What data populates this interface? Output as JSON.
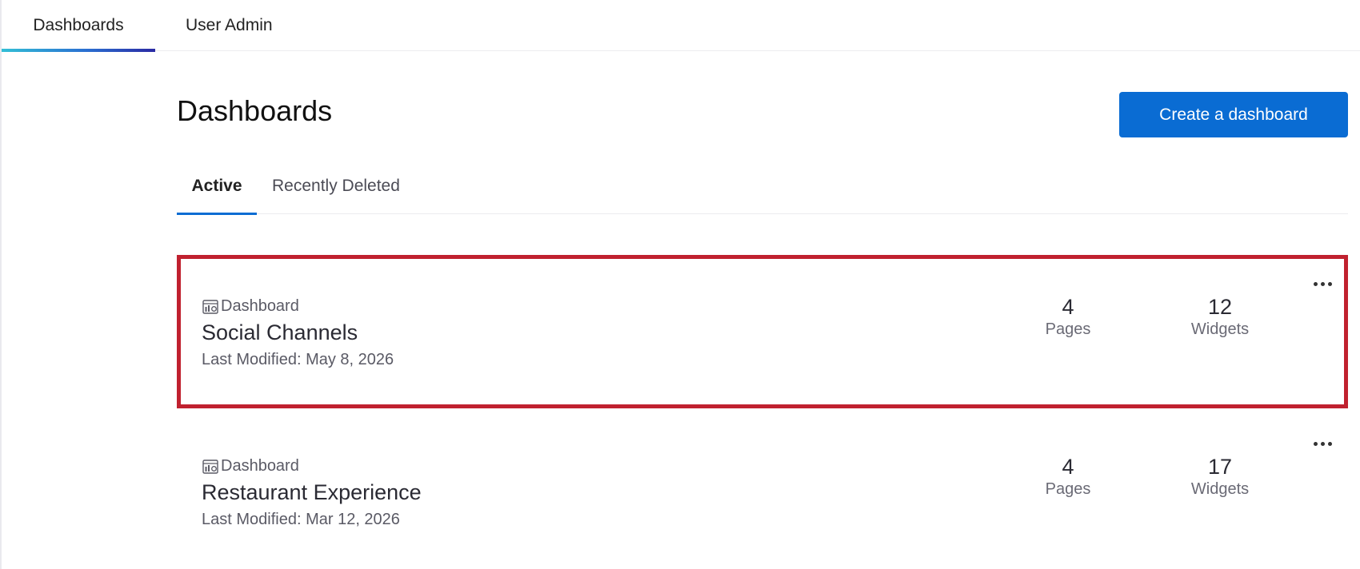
{
  "topnav": {
    "tabs": [
      {
        "label": "Dashboards",
        "active": true
      },
      {
        "label": "User Admin",
        "active": false
      }
    ]
  },
  "header": {
    "title": "Dashboards",
    "create_button": "Create a dashboard"
  },
  "subtabs": [
    {
      "label": "Active",
      "active": true
    },
    {
      "label": "Recently Deleted",
      "active": false
    }
  ],
  "cards": [
    {
      "type_label": "Dashboard",
      "type_icon": "dashboard-icon",
      "name": "Social Channels",
      "modified": "Last Modified: May 8, 2026",
      "pages_count": "4",
      "pages_label": "Pages",
      "widgets_count": "12",
      "widgets_label": "Widgets",
      "highlighted": true
    },
    {
      "type_label": "Dashboard",
      "type_icon": "dashboard-icon",
      "name": "Restaurant Experience",
      "modified": "Last Modified: Mar 12, 2026",
      "pages_count": "4",
      "pages_label": "Pages",
      "widgets_count": "17",
      "widgets_label": "Widgets",
      "highlighted": false
    }
  ],
  "colors": {
    "primary": "#0a6cd3",
    "highlight_border": "#c0212f",
    "tab_gradient_start": "#33bfd6",
    "tab_gradient_end": "#2a2aa3"
  }
}
